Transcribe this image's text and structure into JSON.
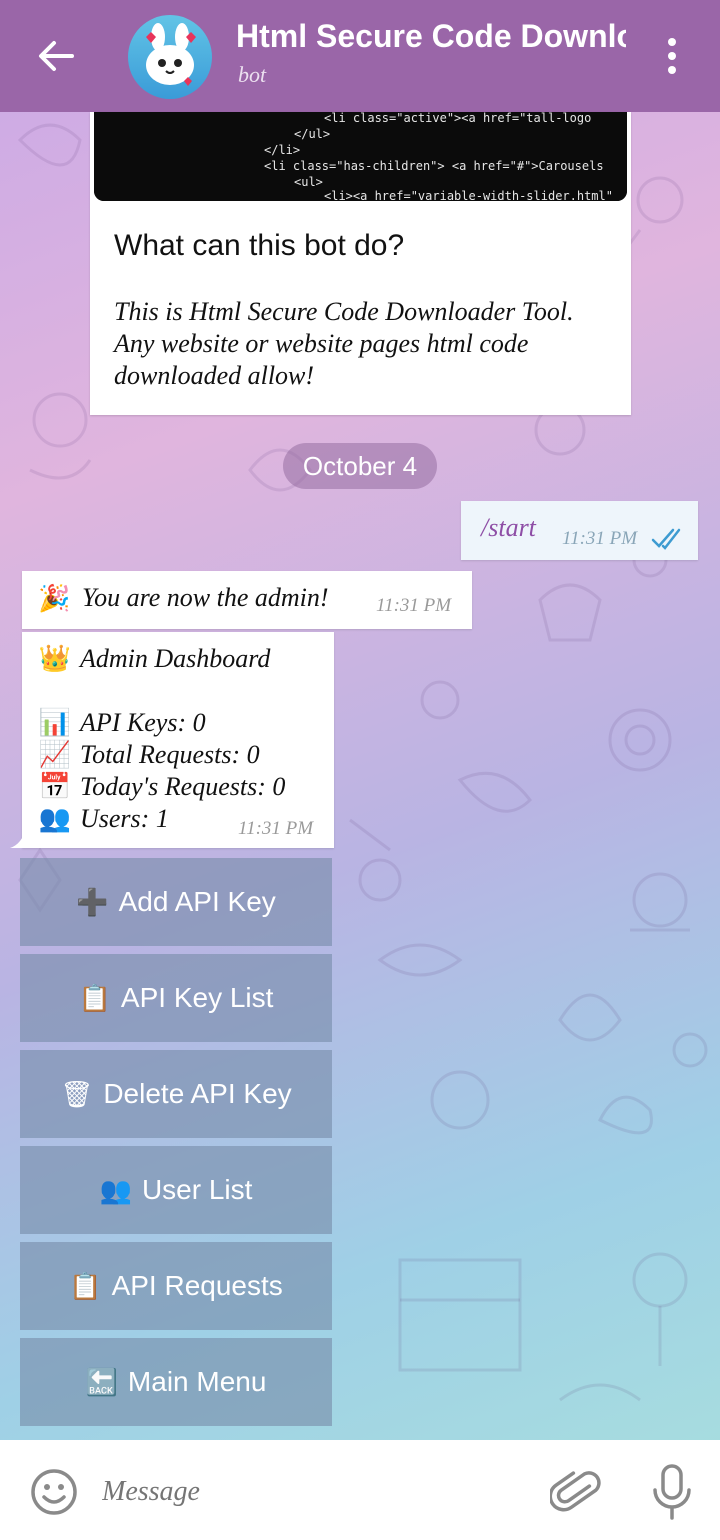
{
  "header": {
    "title": "Html Secure Code Downloader",
    "subtitle": "bot"
  },
  "intro": {
    "heading": "What can this bot do?",
    "description": "This is Html Secure Code Downloader Tool. Any website or website pages html code downloaded allow!",
    "code_lines": [
      "<li class=\"active\"><a href=\"tall-logo",
      "</ul>",
      "</li>",
      "<li class=\"has-children\"> <a href=\"#\">Carousels",
      "<ul>",
      "<li><a href=\"variable-width-slider.html\""
    ]
  },
  "date_separator": "October 4",
  "messages": {
    "outgoing": {
      "text": "/start",
      "time": "11:31 PM"
    },
    "admin_notice": {
      "emoji": "🎉",
      "text": "You are now the admin!",
      "time": "11:31 PM"
    },
    "dashboard": {
      "lines": [
        {
          "icon": "👑",
          "text": "Admin Dashboard"
        },
        {
          "icon": "📊",
          "text": "API Keys: 0"
        },
        {
          "icon": "📈",
          "text": "Total Requests: 0"
        },
        {
          "icon": "📅",
          "text": "Today's Requests: 0"
        },
        {
          "icon": "👥",
          "text": "Users: 1"
        }
      ],
      "time": "11:31 PM"
    }
  },
  "keyboard": [
    {
      "icon": "➕",
      "label": "Add API Key"
    },
    {
      "icon": "📋",
      "label": "API Key List"
    },
    {
      "icon": "🗑",
      "label": "Delete API Key"
    },
    {
      "icon": "👥",
      "label": "User List"
    },
    {
      "icon": "📋",
      "label": "API Requests"
    },
    {
      "icon": "🔙",
      "label": "Main Menu"
    }
  ],
  "composer": {
    "placeholder": "Message"
  },
  "colors": {
    "header": "#9a66a8",
    "accent_text": "#8e4ea6",
    "button_bg": "#788caa"
  }
}
